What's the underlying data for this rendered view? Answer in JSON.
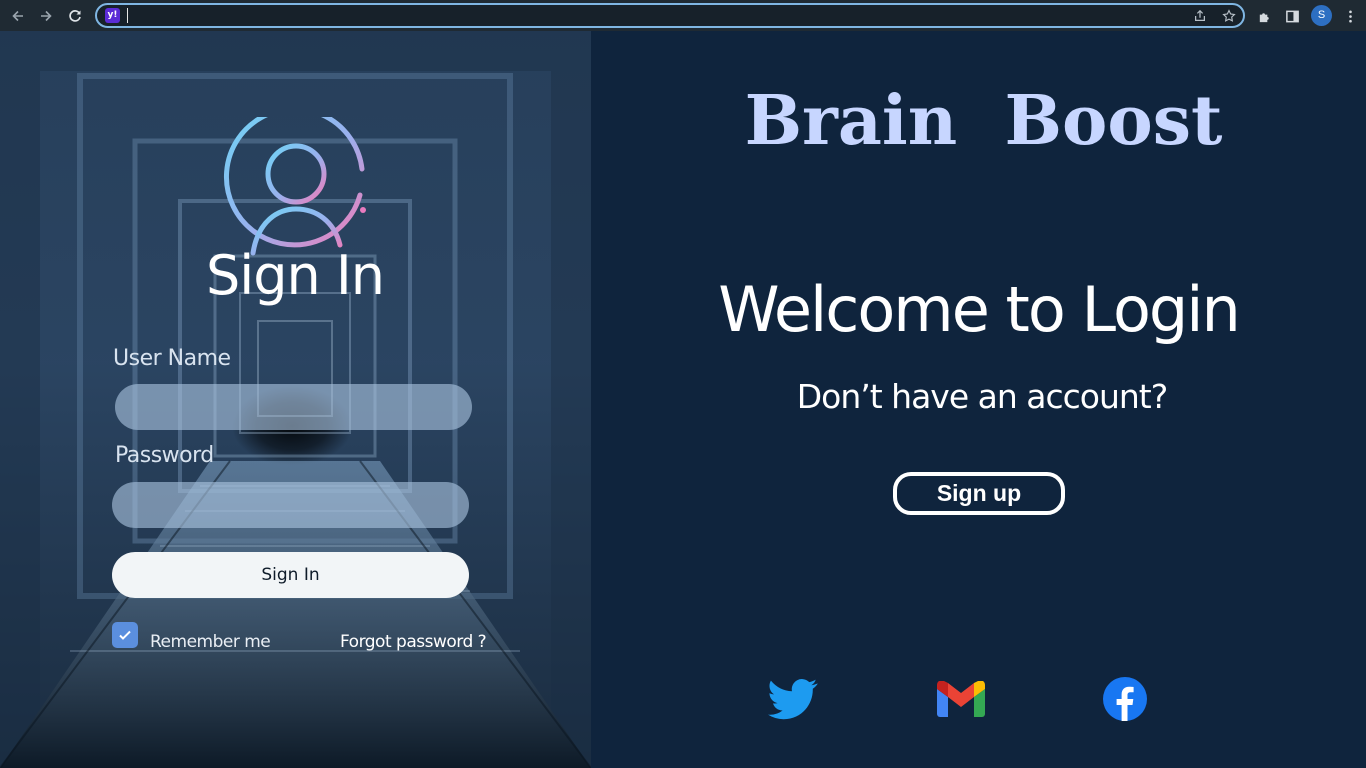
{
  "browser": {
    "address_value": "",
    "icons": [
      "back-arrow-icon",
      "forward-arrow-icon",
      "reload-icon",
      "yahoo-favicon",
      "share-icon",
      "star-icon",
      "extensions-icon",
      "side-panel-icon",
      "kebab-menu-icon"
    ],
    "favicon_letter": "y!",
    "profile_initial": "S",
    "colors": {
      "address_border": "#7fb6e3",
      "profile": "#2d6fc2"
    }
  },
  "signin": {
    "title": "Sign In",
    "username_label": "User Name",
    "username_value": "",
    "password_label": "Password",
    "password_value": "",
    "submit_label": "Sign In",
    "remember_label": "Remember me",
    "remember_checked": true,
    "forgot_label": "Forgot password ?",
    "avatar_icon": "user-circle-icon"
  },
  "welcome": {
    "brand": "Brain  Boost",
    "heading": "Welcome to Login",
    "prompt": "Don’t have an account?",
    "signup_label": "Sign up"
  },
  "social": {
    "icons": [
      "twitter-icon",
      "gmail-icon",
      "facebook-icon"
    ],
    "colors": {
      "twitter": "#1d9bf0",
      "facebook": "#1877f2"
    }
  },
  "colors": {
    "right_background": "#0f243d",
    "brand_text": "#c7d6ff",
    "checkbox": "#5b8fde"
  }
}
